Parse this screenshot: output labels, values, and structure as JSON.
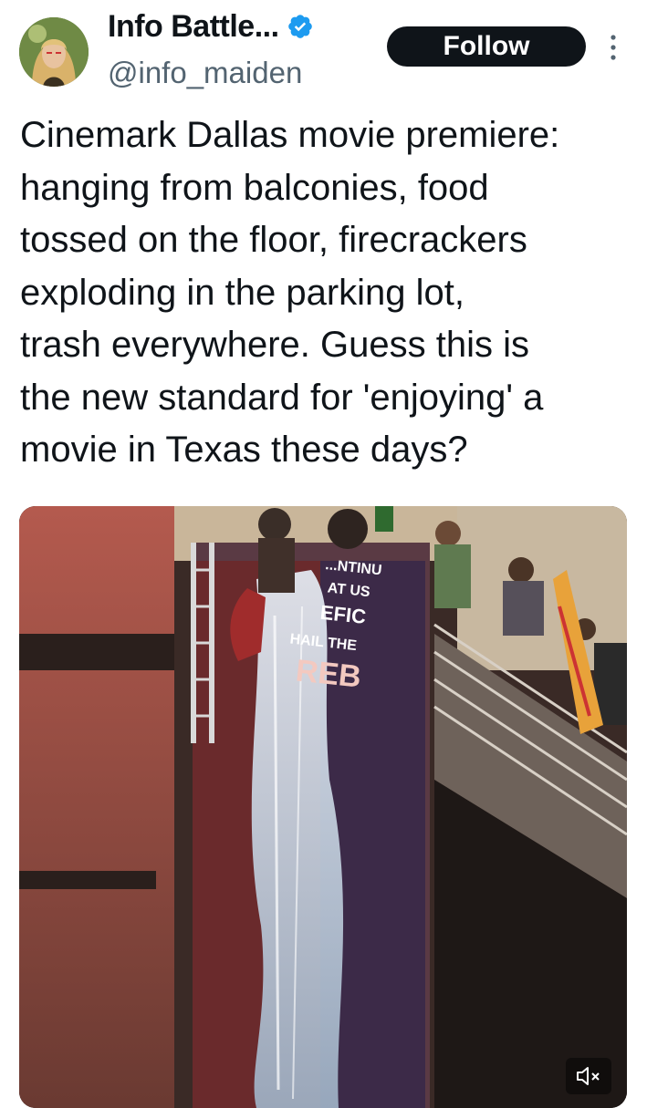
{
  "author": {
    "display_name": "Info Battle...",
    "handle": "@info_maiden",
    "verified": true
  },
  "actions": {
    "follow_label": "Follow"
  },
  "icons": {
    "verified": "verified-badge-icon",
    "more": "more-vertical-icon",
    "mute": "volume-muted-icon"
  },
  "tweet": {
    "text": "Cinemark Dallas movie premiere:\nhanging from balconies, food\ntossed on the floor, firecrackers\nexploding in the parking lot,\ntrash everywhere. Guess this is\nthe new standard for 'enjoying' a\nmovie in Texas these days?"
  },
  "media": {
    "type": "video",
    "banner_text_lines": [
      "...NTINU",
      "AT US",
      "EFIC",
      "HAIL THE",
      "REB"
    ]
  },
  "colors": {
    "accent": "#1d9bf0",
    "button_bg": "#0f1419",
    "secondary_text": "#536471"
  }
}
